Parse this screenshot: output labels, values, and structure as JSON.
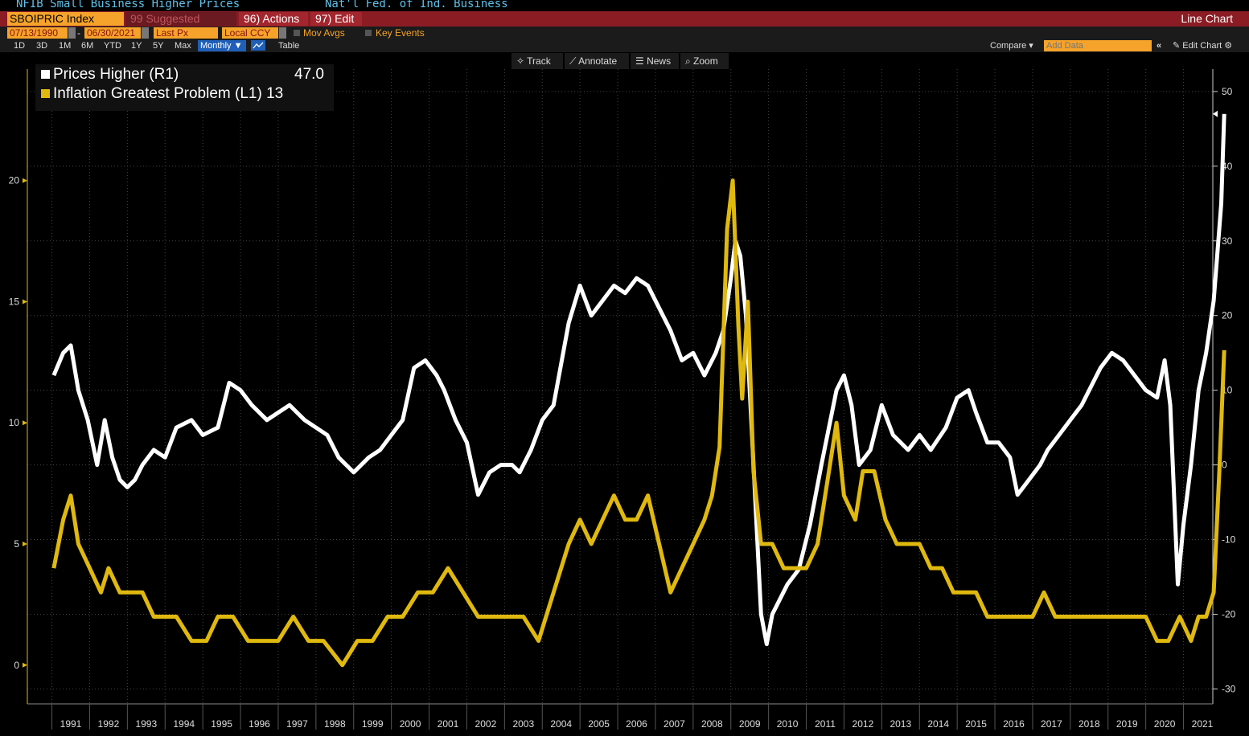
{
  "header": {
    "title_left": "NFIB Small Business Higher Prices",
    "title_right": "Nat'l Fed. of Ind. Business",
    "ticker": "SBOIPRIC Index",
    "suggested": "99 Suggested Charts",
    "actions": "96) Actions ▾",
    "edit": "97) Edit ▾",
    "chart_type": "Line Chart"
  },
  "controls": {
    "start_date": "07/13/1990",
    "end_date": "06/30/2021",
    "field": "Last Px",
    "currency": "Local CCY",
    "mov_avgs": "Mov Avgs",
    "key_events": "Key Events",
    "ranges": [
      "1D",
      "3D",
      "1M",
      "6M",
      "YTD",
      "1Y",
      "5Y",
      "Max"
    ],
    "period": "Monthly ▼",
    "table": "Table",
    "compare": "Compare ▾",
    "add_data_placeholder": "Add Data",
    "edit_chart": "✎ Edit Chart ⚙"
  },
  "toolbar": {
    "track": "✧ Track",
    "annotate": "⟋ Annotate",
    "news": "☰ News",
    "zoom": "⌕ Zoom"
  },
  "legend": {
    "prices_label": "Prices Higher (R1)",
    "prices_value": "47.0",
    "inflation_label": "Inflation Greatest Problem (L1) 13"
  },
  "colors": {
    "prices": "#ffffff",
    "inflation": "#e0b90e",
    "header_bar": "#8b1c24",
    "accent": "#f5a32a"
  },
  "chart_data": {
    "type": "line",
    "x_axis": {
      "tick_labels": [
        "1991",
        "1992",
        "1993",
        "1994",
        "1995",
        "1996",
        "1997",
        "1998",
        "1999",
        "2000",
        "2001",
        "2002",
        "2003",
        "2004",
        "2005",
        "2006",
        "2007",
        "2008",
        "2009",
        "2010",
        "2011",
        "2012",
        "2013",
        "2014",
        "2015",
        "2016",
        "2017",
        "2018",
        "2019",
        "2020",
        "2021"
      ]
    },
    "left_axis": {
      "ticks": [
        0,
        5,
        10,
        15,
        20
      ],
      "range": [
        -1.6,
        24.6
      ]
    },
    "right_axis": {
      "ticks": [
        -30,
        -20,
        -10,
        0,
        10,
        20,
        30,
        40,
        50
      ],
      "range": [
        -32,
        53
      ]
    },
    "grid": true,
    "legend_position": "top-left",
    "series": [
      {
        "name": "Prices Higher",
        "axis": "right",
        "points": [
          [
            1990.55,
            12
          ],
          [
            1990.8,
            15
          ],
          [
            1991.0,
            16
          ],
          [
            1991.2,
            10
          ],
          [
            1991.45,
            6
          ],
          [
            1991.7,
            0
          ],
          [
            1991.9,
            6
          ],
          [
            1992.1,
            1
          ],
          [
            1992.3,
            -2
          ],
          [
            1992.5,
            -3
          ],
          [
            1992.7,
            -2
          ],
          [
            1992.9,
            0
          ],
          [
            1993.2,
            2
          ],
          [
            1993.5,
            1
          ],
          [
            1993.8,
            5
          ],
          [
            1994.2,
            6
          ],
          [
            1994.5,
            4
          ],
          [
            1994.9,
            5
          ],
          [
            1995.2,
            11
          ],
          [
            1995.5,
            10
          ],
          [
            1995.8,
            8
          ],
          [
            1996.2,
            6
          ],
          [
            1996.5,
            7
          ],
          [
            1996.8,
            8
          ],
          [
            1997.2,
            6
          ],
          [
            1997.5,
            5
          ],
          [
            1997.8,
            4
          ],
          [
            1998.1,
            1
          ],
          [
            1998.5,
            -1
          ],
          [
            1998.9,
            1
          ],
          [
            1999.2,
            2
          ],
          [
            1999.5,
            4
          ],
          [
            1999.8,
            6
          ],
          [
            2000.1,
            13
          ],
          [
            2000.4,
            14
          ],
          [
            2000.7,
            12
          ],
          [
            2000.9,
            10
          ],
          [
            2001.2,
            6
          ],
          [
            2001.5,
            3
          ],
          [
            2001.8,
            -4
          ],
          [
            2002.1,
            -1
          ],
          [
            2002.4,
            0
          ],
          [
            2002.7,
            0
          ],
          [
            2002.9,
            -1
          ],
          [
            2003.2,
            2
          ],
          [
            2003.5,
            6
          ],
          [
            2003.8,
            8
          ],
          [
            2004.2,
            19
          ],
          [
            2004.5,
            24
          ],
          [
            2004.8,
            20
          ],
          [
            2005.1,
            22
          ],
          [
            2005.4,
            24
          ],
          [
            2005.7,
            23
          ],
          [
            2006.0,
            25
          ],
          [
            2006.3,
            24
          ],
          [
            2006.6,
            21
          ],
          [
            2006.9,
            18
          ],
          [
            2007.2,
            14
          ],
          [
            2007.5,
            15
          ],
          [
            2007.8,
            12
          ],
          [
            2008.1,
            15
          ],
          [
            2008.3,
            18
          ],
          [
            2008.5,
            25
          ],
          [
            2008.62,
            30
          ],
          [
            2008.75,
            28
          ],
          [
            2008.9,
            20
          ],
          [
            2009.1,
            0
          ],
          [
            2009.3,
            -20
          ],
          [
            2009.45,
            -24
          ],
          [
            2009.6,
            -20
          ],
          [
            2009.8,
            -18
          ],
          [
            2010.0,
            -16
          ],
          [
            2010.3,
            -14
          ],
          [
            2010.6,
            -8
          ],
          [
            2010.9,
            0
          ],
          [
            2011.1,
            5
          ],
          [
            2011.3,
            10
          ],
          [
            2011.5,
            12
          ],
          [
            2011.7,
            8
          ],
          [
            2011.9,
            0
          ],
          [
            2012.2,
            2
          ],
          [
            2012.5,
            8
          ],
          [
            2012.8,
            4
          ],
          [
            2013.2,
            2
          ],
          [
            2013.5,
            4
          ],
          [
            2013.8,
            2
          ],
          [
            2014.2,
            5
          ],
          [
            2014.5,
            9
          ],
          [
            2014.8,
            10
          ],
          [
            2015.0,
            7
          ],
          [
            2015.3,
            3
          ],
          [
            2015.6,
            3
          ],
          [
            2015.9,
            1
          ],
          [
            2016.1,
            -4
          ],
          [
            2016.4,
            -2
          ],
          [
            2016.7,
            0
          ],
          [
            2016.9,
            2
          ],
          [
            2017.2,
            4
          ],
          [
            2017.5,
            6
          ],
          [
            2017.8,
            8
          ],
          [
            2018.0,
            10
          ],
          [
            2018.3,
            13
          ],
          [
            2018.6,
            15
          ],
          [
            2018.9,
            14
          ],
          [
            2019.2,
            12
          ],
          [
            2019.5,
            10
          ],
          [
            2019.8,
            9
          ],
          [
            2020.0,
            14
          ],
          [
            2020.15,
            8
          ],
          [
            2020.35,
            -16
          ],
          [
            2020.5,
            -8
          ],
          [
            2020.7,
            0
          ],
          [
            2020.9,
            10
          ],
          [
            2021.1,
            15
          ],
          [
            2021.3,
            22
          ],
          [
            2021.5,
            35
          ],
          [
            2021.58,
            47
          ]
        ]
      },
      {
        "name": "Inflation Greatest Problem",
        "axis": "left",
        "points": [
          [
            1990.55,
            4
          ],
          [
            1990.8,
            6
          ],
          [
            1991.0,
            7
          ],
          [
            1991.2,
            5
          ],
          [
            1991.5,
            4
          ],
          [
            1991.8,
            3
          ],
          [
            1992.0,
            4
          ],
          [
            1992.3,
            3
          ],
          [
            1992.6,
            3
          ],
          [
            1992.9,
            3
          ],
          [
            1993.2,
            2
          ],
          [
            1993.5,
            2
          ],
          [
            1993.8,
            2
          ],
          [
            1994.2,
            1
          ],
          [
            1994.6,
            1
          ],
          [
            1994.9,
            2
          ],
          [
            1995.3,
            2
          ],
          [
            1995.7,
            1
          ],
          [
            1996.1,
            1
          ],
          [
            1996.5,
            1
          ],
          [
            1996.9,
            2
          ],
          [
            1997.3,
            1
          ],
          [
            1997.7,
            1
          ],
          [
            1998.2,
            0
          ],
          [
            1998.6,
            1
          ],
          [
            1999.0,
            1
          ],
          [
            1999.4,
            2
          ],
          [
            1999.8,
            2
          ],
          [
            2000.2,
            3
          ],
          [
            2000.6,
            3
          ],
          [
            2001.0,
            4
          ],
          [
            2001.4,
            3
          ],
          [
            2001.8,
            2
          ],
          [
            2002.2,
            2
          ],
          [
            2002.6,
            2
          ],
          [
            2003.0,
            2
          ],
          [
            2003.4,
            1
          ],
          [
            2003.8,
            3
          ],
          [
            2004.2,
            5
          ],
          [
            2004.5,
            6
          ],
          [
            2004.8,
            5
          ],
          [
            2005.1,
            6
          ],
          [
            2005.4,
            7
          ],
          [
            2005.7,
            6
          ],
          [
            2006.0,
            6
          ],
          [
            2006.3,
            7
          ],
          [
            2006.6,
            5
          ],
          [
            2006.9,
            3
          ],
          [
            2007.2,
            4
          ],
          [
            2007.5,
            5
          ],
          [
            2007.8,
            6
          ],
          [
            2008.0,
            7
          ],
          [
            2008.2,
            9
          ],
          [
            2008.4,
            18
          ],
          [
            2008.55,
            20
          ],
          [
            2008.7,
            14
          ],
          [
            2008.8,
            11
          ],
          [
            2008.95,
            15
          ],
          [
            2009.1,
            8
          ],
          [
            2009.3,
            5
          ],
          [
            2009.6,
            5
          ],
          [
            2009.9,
            4
          ],
          [
            2010.2,
            4
          ],
          [
            2010.5,
            4
          ],
          [
            2010.8,
            5
          ],
          [
            2011.1,
            8
          ],
          [
            2011.3,
            10
          ],
          [
            2011.5,
            7
          ],
          [
            2011.8,
            6
          ],
          [
            2012.0,
            8
          ],
          [
            2012.3,
            8
          ],
          [
            2012.6,
            6
          ],
          [
            2012.9,
            5
          ],
          [
            2013.2,
            5
          ],
          [
            2013.5,
            5
          ],
          [
            2013.8,
            4
          ],
          [
            2014.1,
            4
          ],
          [
            2014.4,
            3
          ],
          [
            2014.7,
            3
          ],
          [
            2015.0,
            3
          ],
          [
            2015.3,
            2
          ],
          [
            2015.6,
            2
          ],
          [
            2015.9,
            2
          ],
          [
            2016.2,
            2
          ],
          [
            2016.5,
            2
          ],
          [
            2016.8,
            3
          ],
          [
            2017.1,
            2
          ],
          [
            2017.4,
            2
          ],
          [
            2017.7,
            2
          ],
          [
            2018.0,
            2
          ],
          [
            2018.3,
            2
          ],
          [
            2018.6,
            2
          ],
          [
            2018.9,
            2
          ],
          [
            2019.2,
            2
          ],
          [
            2019.5,
            2
          ],
          [
            2019.8,
            1
          ],
          [
            2020.1,
            1
          ],
          [
            2020.4,
            2
          ],
          [
            2020.7,
            1
          ],
          [
            2020.9,
            2
          ],
          [
            2021.1,
            2
          ],
          [
            2021.3,
            3
          ],
          [
            2021.45,
            8
          ],
          [
            2021.58,
            13
          ]
        ]
      }
    ]
  }
}
